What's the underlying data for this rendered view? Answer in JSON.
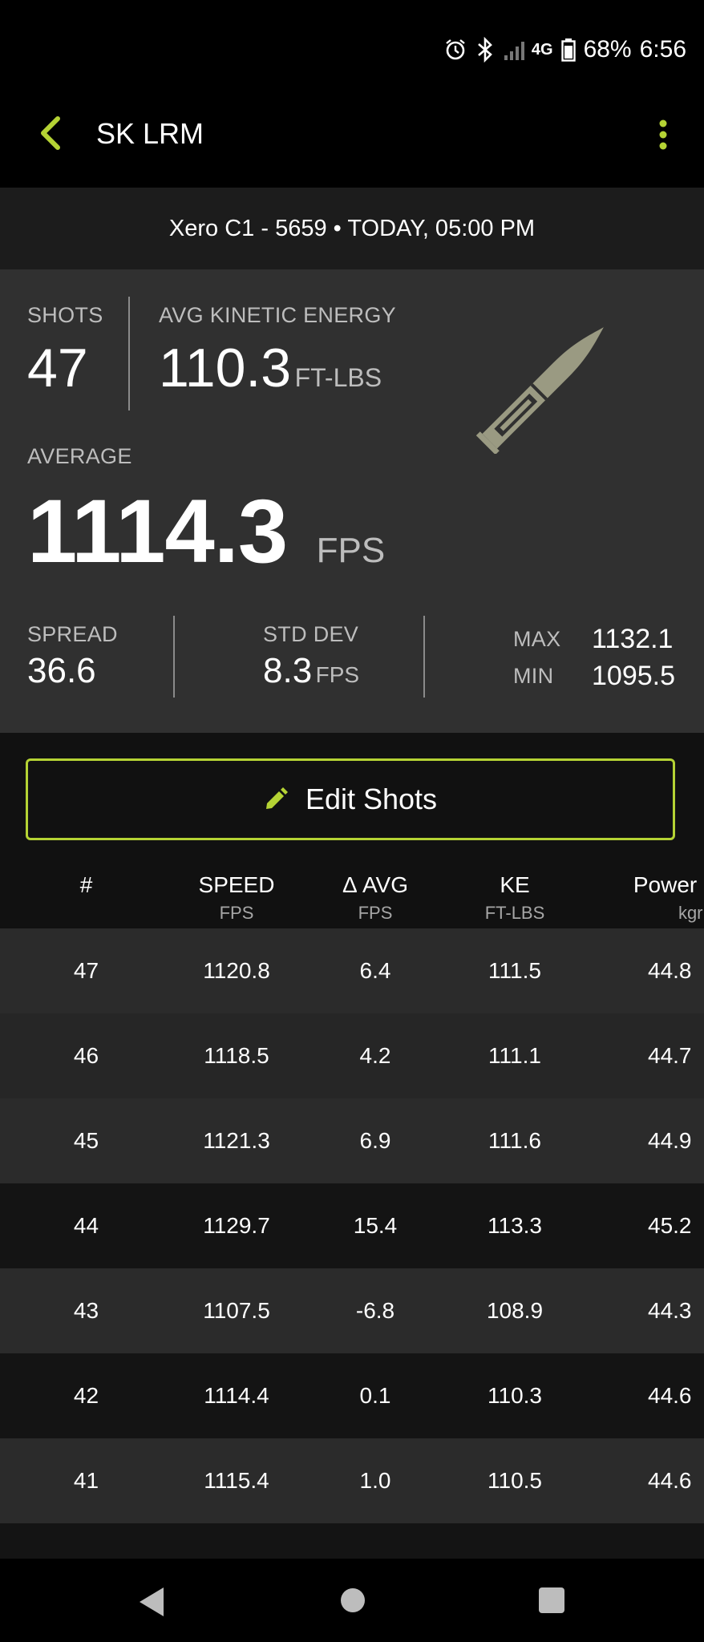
{
  "status_bar": {
    "network": "4G",
    "battery": "68%",
    "time": "6:56",
    "icons": [
      "alarm-icon",
      "bluetooth-icon",
      "signal-icon",
      "battery-icon"
    ]
  },
  "app_bar": {
    "title": "SK LRM",
    "back_icon": "chevron-left-icon",
    "menu_icon": "more-vert-icon"
  },
  "session": {
    "label": "Xero C1 - 5659 • TODAY, 05:00 PM"
  },
  "stats": {
    "shots_label": "SHOTS",
    "shots": "47",
    "ke_label": "AVG KINETIC ENERGY",
    "ke_value": "110.3",
    "ke_unit": "FT-LBS",
    "average_label": "AVERAGE",
    "average_value": "1114.3",
    "average_unit": "FPS",
    "spread_label": "SPREAD",
    "spread_value": "36.6",
    "stddev_label": "STD DEV",
    "stddev_value": "8.3",
    "stddev_unit": "FPS",
    "max_label": "MAX",
    "max_value": "1132.1",
    "min_label": "MIN",
    "min_value": "1095.5",
    "image_icon": "bullet-icon"
  },
  "edit_button": {
    "label": "Edit Shots",
    "icon": "pencil-icon"
  },
  "table": {
    "columns": [
      {
        "title": "#",
        "unit": ""
      },
      {
        "title": "SPEED",
        "unit": "FPS"
      },
      {
        "title": "Δ AVG",
        "unit": "FPS"
      },
      {
        "title": "KE",
        "unit": "FT-LBS"
      },
      {
        "title": "Power F",
        "unit": "kgr·ft"
      }
    ],
    "rows": [
      [
        "47",
        "1120.8",
        "6.4",
        "111.5",
        "44.8"
      ],
      [
        "46",
        "1118.5",
        "4.2",
        "111.1",
        "44.7"
      ],
      [
        "45",
        "1121.3",
        "6.9",
        "111.6",
        "44.9"
      ],
      [
        "44",
        "1129.7",
        "15.4",
        "113.3",
        "45.2"
      ],
      [
        "43",
        "1107.5",
        "-6.8",
        "108.9",
        "44.3"
      ],
      [
        "42",
        "1114.4",
        "0.1",
        "110.3",
        "44.6"
      ],
      [
        "41",
        "1115.4",
        "1.0",
        "110.5",
        "44.6"
      ]
    ]
  },
  "nav_bar": {
    "icons": [
      "back-triangle-icon",
      "home-circle-icon",
      "recents-square-icon"
    ]
  },
  "colors": {
    "accent": "#b5d334",
    "panel": "#303030",
    "bullet": "#9a9a82"
  }
}
